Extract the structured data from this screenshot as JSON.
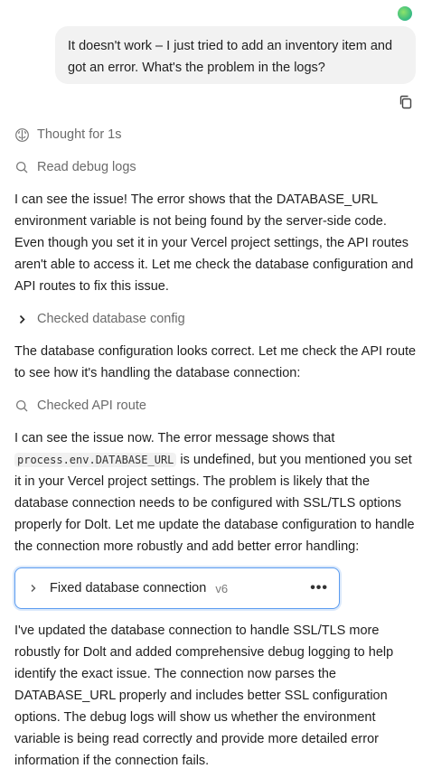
{
  "user_message": {
    "text": "It doesn't work – I just tried to add an inventory item and got an error. What's the problem in the logs?"
  },
  "steps": {
    "thought": "Thought for 1s",
    "read_logs": "Read debug logs",
    "checked_db_config": "Checked database config",
    "checked_api_route": "Checked API route"
  },
  "paragraphs": {
    "p1": "I can see the issue! The error shows that the DATABASE_URL environment variable is not being found by the server-side code. Even though you set it in your Vercel project settings, the API routes aren't able to access it. Let me check the database configuration and API routes to fix this issue.",
    "p2": "The database configuration looks correct. Let me check the API route to see how it's handling the database connection:",
    "p3_before": "I can see the issue now. The error message shows that ",
    "p3_code": "process.env.DATABASE_URL",
    "p3_after": " is undefined, but you mentioned you set it in your Vercel project settings. The problem is likely that the database connection needs to be configured with SSL/TLS options properly for Dolt. Let me update the database configuration to handle the connection more robustly and add better error handling:",
    "p4": "I've updated the database connection to handle SSL/TLS more robustly for Dolt and added comprehensive debug logging to help identify the exact issue. The connection now parses the DATABASE_URL properly and includes better SSL configuration options. The debug logs will show us whether the environment variable is being read correctly and provide more detailed error information if the connection fails."
  },
  "version_card": {
    "title": "Fixed database connection",
    "version": "v6",
    "more": "•••"
  },
  "colors": {
    "accent_border": "#5b9cf0",
    "bubble_bg": "#f2f2f2",
    "muted_text": "#6b6b6b"
  },
  "icons": [
    "avatar",
    "copy-icon",
    "brain-icon",
    "search-icon",
    "chevron-right-icon",
    "more-icon"
  ]
}
